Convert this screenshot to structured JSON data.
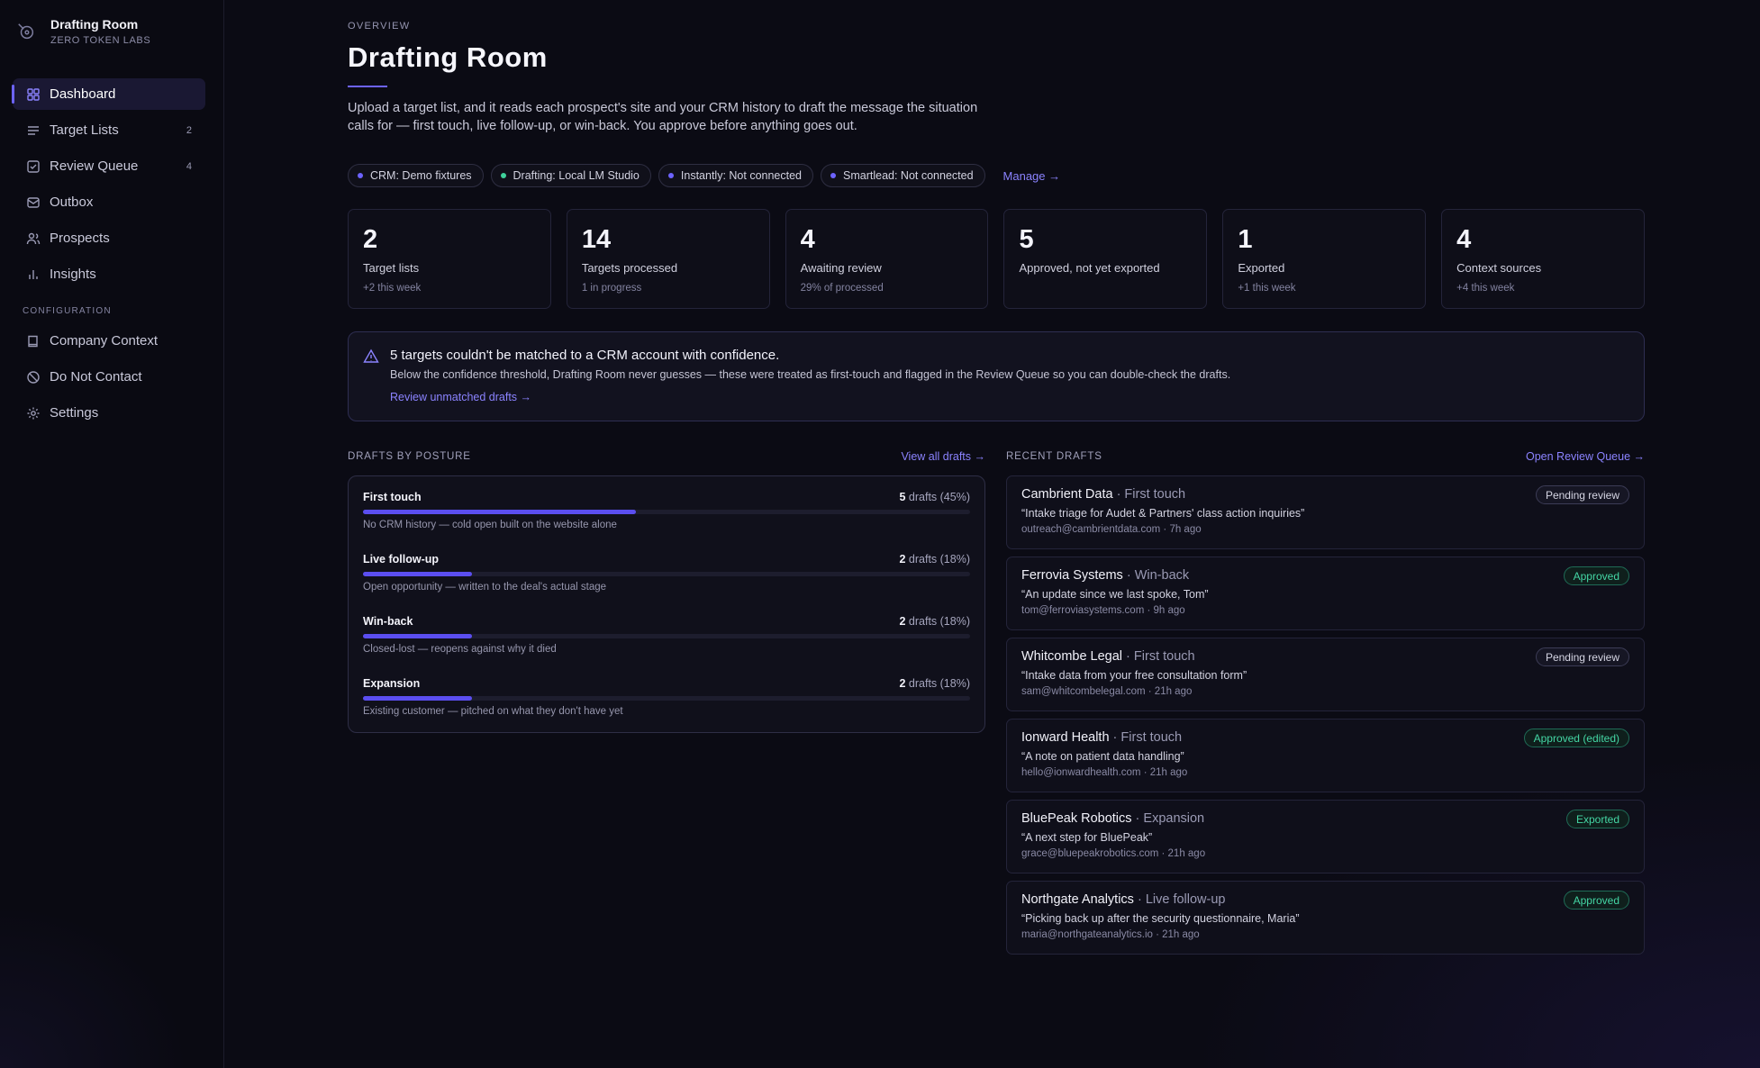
{
  "brand": {
    "name": "Drafting Room",
    "org": "ZERO TOKEN LABS"
  },
  "nav": {
    "items": [
      {
        "label": "Dashboard",
        "count": "",
        "icon": "grid-icon",
        "active": true
      },
      {
        "label": "Target Lists",
        "count": "2",
        "icon": "list-icon"
      },
      {
        "label": "Review Queue",
        "count": "4",
        "icon": "checkbox-icon"
      },
      {
        "label": "Outbox",
        "count": "",
        "icon": "mail-icon"
      },
      {
        "label": "Prospects",
        "count": "",
        "icon": "users-icon"
      },
      {
        "label": "Insights",
        "count": "",
        "icon": "bar-chart-icon"
      }
    ],
    "config_title": "CONFIGURATION",
    "config_items": [
      {
        "label": "Company Context",
        "icon": "book-icon"
      },
      {
        "label": "Do Not Contact",
        "icon": "block-icon"
      },
      {
        "label": "Settings",
        "icon": "gear-icon"
      }
    ]
  },
  "header": {
    "eyebrow": "OVERVIEW",
    "title": "Drafting Room",
    "intro": "Upload a target list, and it reads each prospect's site and your CRM history to draft the message the situation calls for — first touch, live follow-up, or win-back. You approve before anything goes out."
  },
  "chips": [
    {
      "label": "CRM: Demo fixtures",
      "color": "#6d63ff"
    },
    {
      "label": "Drafting: Local LM Studio",
      "color": "#3fd19b"
    },
    {
      "label": "Instantly: Not connected",
      "color": "#6d63ff"
    },
    {
      "label": "Smartlead: Not connected",
      "color": "#6d63ff"
    }
  ],
  "manage_link": "Manage →",
  "stats": [
    {
      "value": "2",
      "label": "Target lists",
      "sub": "+2 this week"
    },
    {
      "value": "14",
      "label": "Targets processed",
      "sub": "1 in progress"
    },
    {
      "value": "4",
      "label": "Awaiting review",
      "sub": "29% of processed"
    },
    {
      "value": "5",
      "label": "Approved, not yet exported",
      "sub": ""
    },
    {
      "value": "1",
      "label": "Exported",
      "sub": "+1 this week"
    },
    {
      "value": "4",
      "label": "Context sources",
      "sub": "+4 this week"
    }
  ],
  "alert": {
    "title": "5 targets couldn't be matched to a CRM account with confidence.",
    "body": "Below the confidence threshold, Drafting Room never guesses — these were treated as first-touch and flagged in the Review Queue so you can double-check the drafts.",
    "link": "Review unmatched drafts →"
  },
  "posture": {
    "title": "DRAFTS BY POSTURE",
    "link": "View all drafts →",
    "rows": [
      {
        "name": "First touch",
        "count": "5",
        "suffix": " drafts (45%)",
        "fraction": 0.45,
        "desc": "No CRM history — cold open built on the website alone"
      },
      {
        "name": "Live follow-up",
        "count": "2",
        "suffix": " drafts (18%)",
        "fraction": 0.18,
        "desc": "Open opportunity — written to the deal's actual stage"
      },
      {
        "name": "Win-back",
        "count": "2",
        "suffix": " drafts (18%)",
        "fraction": 0.18,
        "desc": "Closed-lost — reopens against why it died"
      },
      {
        "name": "Expansion",
        "count": "2",
        "suffix": " drafts (18%)",
        "fraction": 0.18,
        "desc": "Existing customer — pitched on what they don't have yet"
      }
    ]
  },
  "recent": {
    "title": "RECENT DRAFTS",
    "link": "Open Review Queue →",
    "items": [
      {
        "company": "Cambrient Data",
        "posture": " · First touch",
        "subject": "“Intake triage for Audet & Partners' class action inquiries”",
        "meta": "outreach@cambrientdata.com · 7h ago",
        "status": "Pending review",
        "kind": "pending"
      },
      {
        "company": "Ferrovia Systems",
        "posture": " · Win-back",
        "subject": "“An update since we last spoke, Tom”",
        "meta": "tom@ferroviasystems.com · 9h ago",
        "status": "Approved",
        "kind": "ok"
      },
      {
        "company": "Whitcombe Legal",
        "posture": " · First touch",
        "subject": "“Intake data from your free consultation form”",
        "meta": "sam@whitcombelegal.com · 21h ago",
        "status": "Pending review",
        "kind": "pending"
      },
      {
        "company": "Ionward Health",
        "posture": " · First touch",
        "subject": "“A note on patient data handling”",
        "meta": "hello@ionwardhealth.com · 21h ago",
        "status": "Approved (edited)",
        "kind": "ok"
      },
      {
        "company": "BluePeak Robotics",
        "posture": " · Expansion",
        "subject": "“A next step for BluePeak”",
        "meta": "grace@bluepeakrobotics.com · 21h ago",
        "status": "Exported",
        "kind": "ok"
      },
      {
        "company": "Northgate Analytics",
        "posture": " · Live follow-up",
        "subject": "“Picking back up after the security questionnaire, Maria”",
        "meta": "maria@northgateanalytics.io · 21h ago",
        "status": "Approved",
        "kind": "ok"
      }
    ]
  }
}
